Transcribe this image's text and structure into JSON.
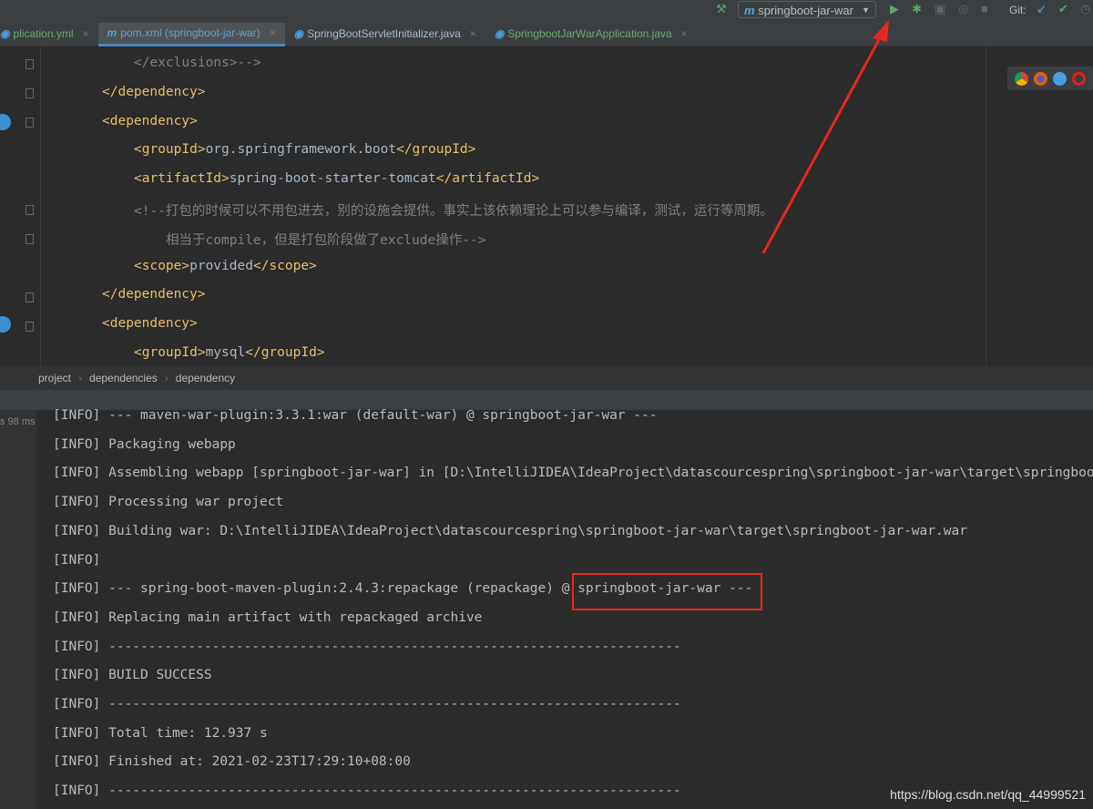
{
  "toolbar": {
    "run_config": "springboot-jar-war",
    "git_label": "Git:"
  },
  "tabs": [
    {
      "label": "plication.yml",
      "style": "green"
    },
    {
      "label": "pom.xml (springboot-jar-war)",
      "style": "active"
    },
    {
      "label": "SpringBootServletInitializer.java",
      "style": ""
    },
    {
      "label": "SpringbootJarWarApplication.java",
      "style": "green"
    }
  ],
  "editor_lines": [
    {
      "indent": 1,
      "kind": "comment",
      "text": "</exclusions>-->"
    },
    {
      "indent": 0,
      "kind": "tag",
      "text": "</dependency>"
    },
    {
      "indent": 0,
      "kind": "tag",
      "text": "<dependency>"
    },
    {
      "indent": 1,
      "kind": "mixed",
      "open": "<groupId>",
      "value": "org.springframework.boot",
      "close": "</groupId>"
    },
    {
      "indent": 1,
      "kind": "mixed",
      "open": "<artifactId>",
      "value": "spring-boot-starter-tomcat",
      "close": "</artifactId>"
    },
    {
      "indent": 1,
      "kind": "comment",
      "text": "<!--打包的时候可以不用包进去，别的设施会提供。事实上该依赖理论上可以参与编译，测试，运行等周期。"
    },
    {
      "indent": 2,
      "kind": "comment",
      "text": "相当于compile，但是打包阶段做了exclude操作-->"
    },
    {
      "indent": 1,
      "kind": "mixed",
      "open": "<scope>",
      "value": "provided",
      "close": "</scope>"
    },
    {
      "indent": 0,
      "kind": "tag",
      "text": "</dependency>"
    },
    {
      "indent": 0,
      "kind": "tag",
      "text": "<dependency>"
    },
    {
      "indent": 1,
      "kind": "mixed",
      "open": "<groupId>",
      "value": "mysql",
      "close": "</groupId>"
    }
  ],
  "breadcrumb": [
    "project",
    "dependencies",
    "dependency"
  ],
  "console": {
    "gutter_time": "s 98 ms",
    "lines": [
      "[INFO] --- maven-war-plugin:3.3.1:war (default-war) @ springboot-jar-war ---",
      "[INFO] Packaging webapp",
      "[INFO] Assembling webapp [springboot-jar-war] in [D:\\IntelliJIDEA\\IdeaProject\\datascourcespring\\springboot-jar-war\\target\\springboot",
      "[INFO] Processing war project",
      "[INFO] Building war: D:\\IntelliJIDEA\\IdeaProject\\datascourcespring\\springboot-jar-war\\target\\springboot-jar-war.war",
      "[INFO]",
      "[INFO] --- spring-boot-maven-plugin:2.4.3:repackage (repackage) @ springboot-jar-war ---",
      "[INFO] Replacing main artifact with repackaged archive",
      "[INFO] ------------------------------------------------------------------------",
      "[INFO] BUILD SUCCESS",
      "[INFO] ------------------------------------------------------------------------",
      "[INFO] Total time: 12.937 s",
      "[INFO] Finished at: 2021-02-23T17:29:10+08:00",
      "[INFO] ------------------------------------------------------------------------"
    ]
  },
  "watermark": "https://blog.csdn.net/qq_44999521"
}
